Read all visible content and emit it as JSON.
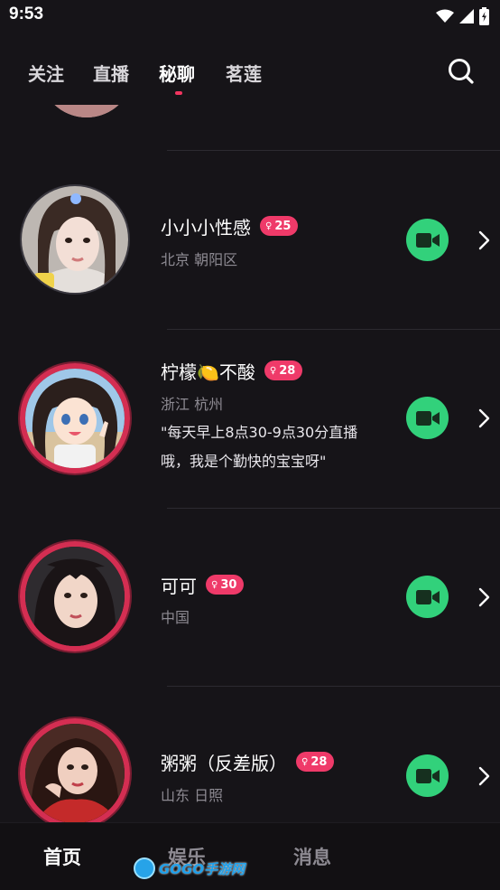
{
  "status_bar": {
    "time": "9:53",
    "icons": [
      "wifi-icon",
      "signal-icon",
      "battery-icon"
    ]
  },
  "top_nav": {
    "tabs": [
      {
        "label": "关注",
        "active": false
      },
      {
        "label": "直播",
        "active": false
      },
      {
        "label": "秘聊",
        "active": true
      },
      {
        "label": "茗莲",
        "active": false
      }
    ],
    "search_icon": "search-icon",
    "accent_color": "#f2355f"
  },
  "users": [
    {
      "name": "小小小性感",
      "badge": "25",
      "badge_icon": "female-icon",
      "location": "北京 朝阳区",
      "live": false
    },
    {
      "name": "柠檬🍋不酸",
      "badge": "28",
      "badge_icon": "female-icon",
      "location": "浙江 杭州",
      "bio_line1": "\"每天早上8点30-9点30分直播",
      "bio_line2": "哦，我是个勤快的宝宝呀\"",
      "live": true
    },
    {
      "name": "可可",
      "badge": "30",
      "badge_icon": "female-icon",
      "location": "中国",
      "live": true
    },
    {
      "name": "粥粥（反差版）",
      "badge": "28",
      "badge_icon": "female-icon",
      "location": "山东 日照",
      "live": true
    }
  ],
  "actions": {
    "video_call_icon": "video-camera-icon",
    "video_button_color": "#32d17b",
    "chevron_icon": "chevron-right-icon"
  },
  "bottom_nav": {
    "tabs": [
      {
        "label": "首页",
        "active": true
      },
      {
        "label": "娱乐",
        "active": false
      },
      {
        "label": "消息",
        "active": false
      }
    ]
  },
  "watermark": {
    "text": "GOGO手游网"
  }
}
